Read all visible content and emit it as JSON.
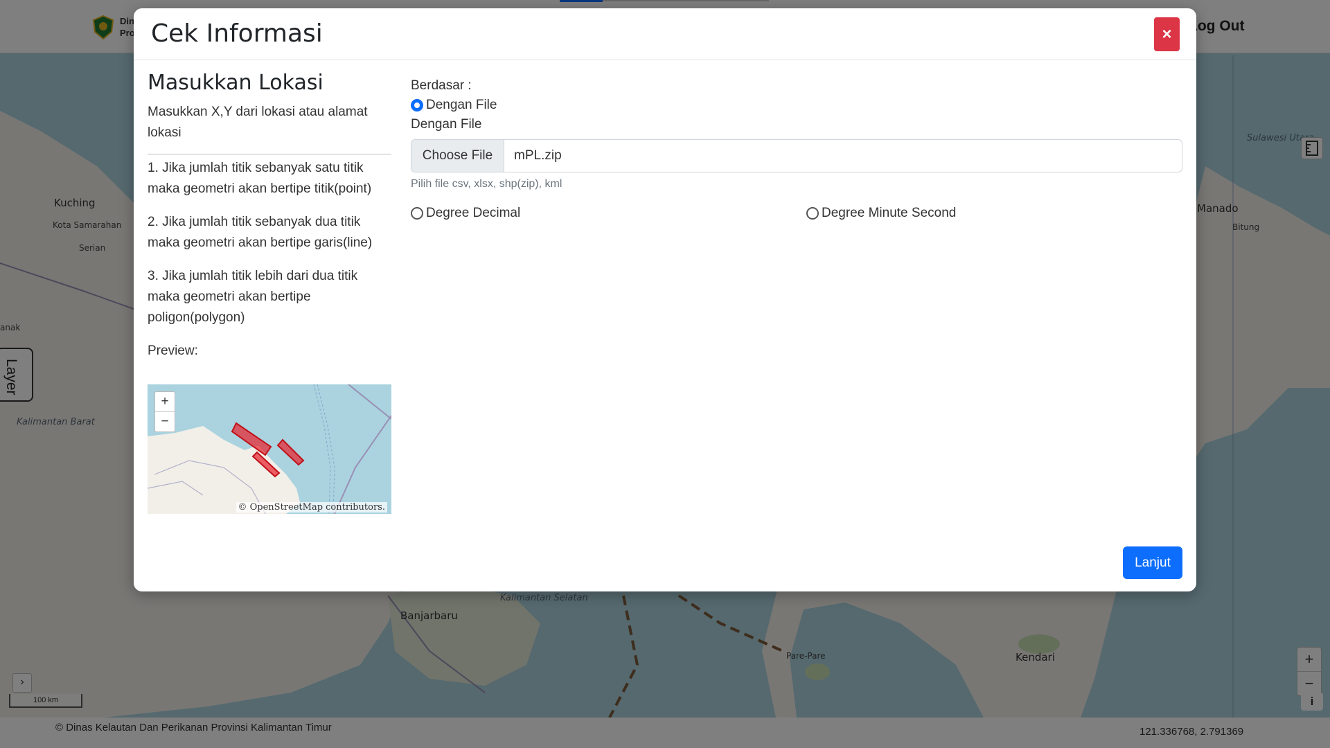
{
  "navbar": {
    "brand_line1": "Dinas",
    "brand_line2": "Prov",
    "logout_label": "Log Out"
  },
  "map": {
    "labels": [
      "Kuching",
      "Kota Samarahan",
      "Serian",
      "Kalimantan Barat",
      "Manado",
      "Bitung",
      "Sulawesi Utara",
      "Banjarbaru",
      "Kalimantan Selatan",
      "Pare-Pare",
      "Kendari",
      "anak"
    ],
    "layer_tab_label": "Layer",
    "scale_label": "100 km",
    "expand_label": "›",
    "zoom_in": "+",
    "zoom_out": "−",
    "info_label": "i"
  },
  "footer": {
    "copyright": "© Dinas Kelautan Dan Perikanan Provinsi Kalimantan Timur",
    "coordinates": "121.336768, 2.791369"
  },
  "modal": {
    "title": "Cek Informasi",
    "close_label": "×",
    "left": {
      "heading": "Masukkan Lokasi",
      "description": "Masukkan X,Y dari lokasi atau alamat lokasi",
      "rules": [
        "1. Jika jumlah titik sebanyak satu titik maka geometri akan bertipe titik(point)",
        "2. Jika jumlah titik sebanyak dua titik maka geometri akan bertipe garis(line)",
        "3. Jika jumlah titik lebih dari dua titik maka geometri akan bertipe poligon(polygon)"
      ],
      "preview_label": "Preview:",
      "preview_zoom_in": "+",
      "preview_zoom_out": "−",
      "preview_attribution": "© OpenStreetMap contributors."
    },
    "right": {
      "based_label": "Berdasar :",
      "option_file": "Dengan File",
      "file_section_label": "Dengan File",
      "choose_file_label": "Choose File",
      "file_name": "mPL.zip",
      "file_help": "Pilih file csv, xlsx, shp(zip), kml",
      "option_decimal": "Degree Decimal",
      "option_dms": "Degree Minute Second"
    },
    "submit_label": "Lanjut"
  },
  "colors": {
    "primary": "#0d6efd",
    "danger": "#dc3545",
    "water": "#aad3df",
    "land": "#f2efe9",
    "polygon": "#e8202a"
  }
}
